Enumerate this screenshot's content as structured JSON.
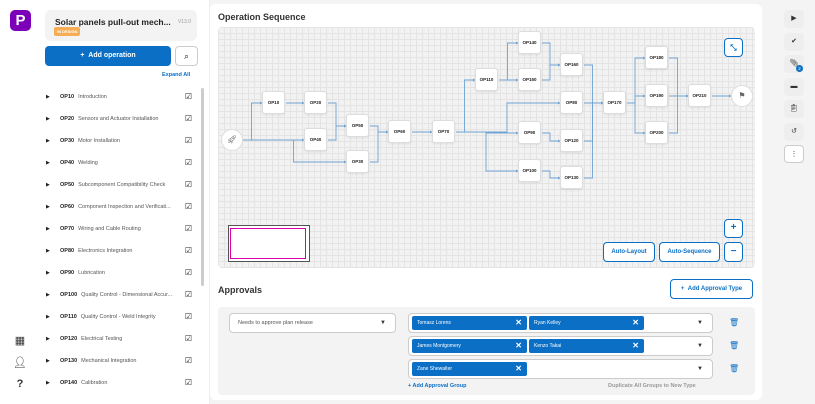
{
  "app": {
    "logo": "P"
  },
  "rail": {
    "icons": [
      "grid-icon",
      "user-icon",
      "help-icon"
    ],
    "help_label": "?"
  },
  "header": {
    "title": "Solar panels pull-out mech...",
    "version": "V13.0",
    "status": "IN DESIGN",
    "status_color": "#f6ad55"
  },
  "sidebar": {
    "add_label": "Add operation",
    "expand_all": "Expand All",
    "items": [
      {
        "code": "OP10",
        "name": "Introduction"
      },
      {
        "code": "OP20",
        "name": "Sensors and Actuator Installation"
      },
      {
        "code": "OP30",
        "name": "Motor Installation"
      },
      {
        "code": "OP40",
        "name": "Welding"
      },
      {
        "code": "OP50",
        "name": "Subcomponent Compatibility Check"
      },
      {
        "code": "OP60",
        "name": "Component Inspection and Verificati..."
      },
      {
        "code": "OP70",
        "name": "Wiring and Cable Routing"
      },
      {
        "code": "OP80",
        "name": "Electronics Integration"
      },
      {
        "code": "OP90",
        "name": "Lubrication"
      },
      {
        "code": "OP100",
        "name": "Quality Control - Dimensional Accur..."
      },
      {
        "code": "OP110",
        "name": "Quality Control - Weld Integrity"
      },
      {
        "code": "OP120",
        "name": "Electrical Testing"
      },
      {
        "code": "OP130",
        "name": "Mechanical Integration"
      },
      {
        "code": "OP140",
        "name": "Calibration"
      }
    ]
  },
  "sequence": {
    "title": "Operation Sequence",
    "auto_layout": "Auto-Layout",
    "auto_sequence": "Auto-Sequence",
    "zoom_in": "+",
    "zoom_out": "−",
    "nodes": [
      "OP10",
      "OP20",
      "OP40",
      "OP50",
      "OP30",
      "OP60",
      "OP70",
      "OP110",
      "OP140",
      "OP150",
      "OP160",
      "OP80",
      "OP90",
      "OP120",
      "OP100",
      "OP130",
      "OP170",
      "OP180",
      "OP190",
      "OP200",
      "OP210"
    ],
    "edges": [
      [
        "START",
        "OP10"
      ],
      [
        "START",
        "OP40"
      ],
      [
        "START",
        "OP30"
      ],
      [
        "OP10",
        "OP20"
      ],
      [
        "OP20",
        "OP50"
      ],
      [
        "OP40",
        "OP50"
      ],
      [
        "OP50",
        "OP60"
      ],
      [
        "OP30",
        "OP60"
      ],
      [
        "OP60",
        "OP70"
      ],
      [
        "OP70",
        "OP110"
      ],
      [
        "OP70",
        "OP80"
      ],
      [
        "OP70",
        "OP90"
      ],
      [
        "OP70",
        "OP100"
      ],
      [
        "OP110",
        "OP140"
      ],
      [
        "OP110",
        "OP150"
      ],
      [
        "OP140",
        "OP160"
      ],
      [
        "OP150",
        "OP160"
      ],
      [
        "OP90",
        "OP120"
      ],
      [
        "OP100",
        "OP130"
      ],
      [
        "OP160",
        "OP170"
      ],
      [
        "OP80",
        "OP170"
      ],
      [
        "OP120",
        "OP170"
      ],
      [
        "OP130",
        "OP170"
      ],
      [
        "OP170",
        "OP180"
      ],
      [
        "OP170",
        "OP190"
      ],
      [
        "OP170",
        "OP200"
      ],
      [
        "OP180",
        "OP210"
      ],
      [
        "OP190",
        "OP210"
      ],
      [
        "OP200",
        "OP210"
      ],
      [
        "OP210",
        "END"
      ]
    ]
  },
  "approvals": {
    "title": "Approvals",
    "add_type": "Add Approval Type",
    "type_value": "Needs to approve plan release",
    "groups": [
      [
        "Tomasz Lorens",
        "Ryan Kelley"
      ],
      [
        "James Montgomery",
        "Kenzo Takai"
      ],
      [
        "Zane Shewalter"
      ]
    ],
    "add_group": "Add Approval Group",
    "duplicate": "Duplicate All Groups to New Type"
  },
  "right_rail": {
    "icons": [
      "play-icon",
      "check-circle-icon",
      "paperclip-icon",
      "comment-icon",
      "clipboard-icon",
      "history-icon",
      "more-icon"
    ],
    "attachment_count": "2"
  },
  "accent": "#0b6fc6"
}
